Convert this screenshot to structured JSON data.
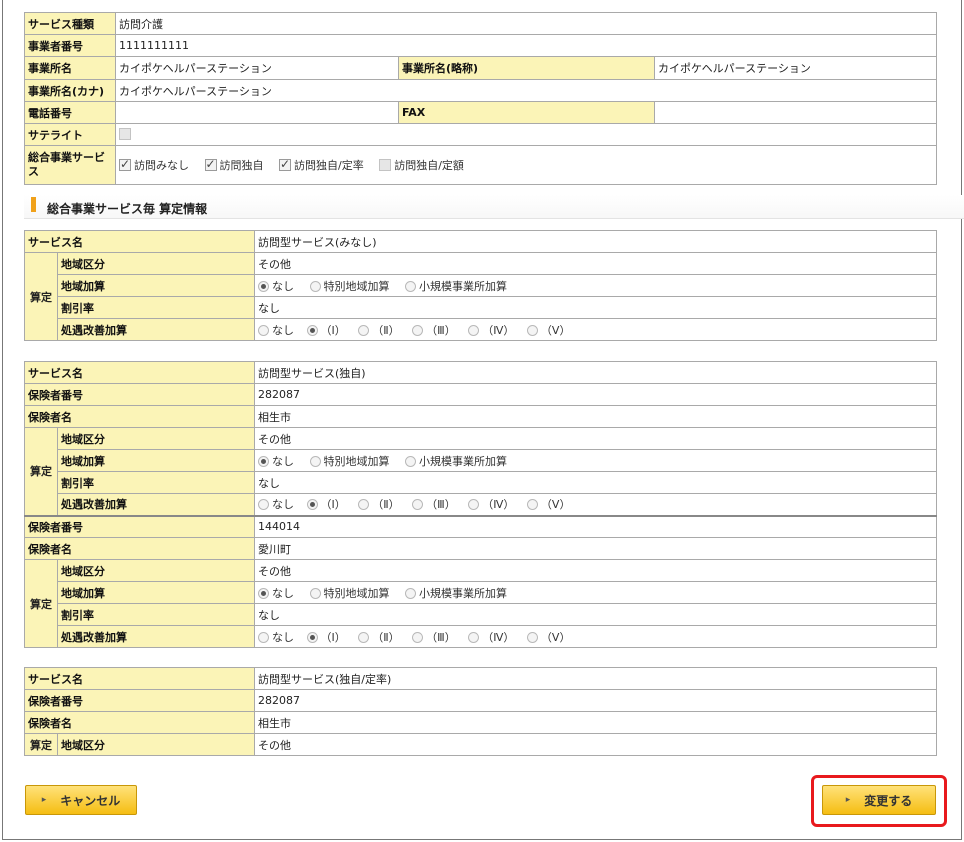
{
  "office": {
    "service_type_label": "サービス種類",
    "service_type": "訪問介護",
    "business_no_label": "事業者番号",
    "business_no": "1111111111",
    "office_name_label": "事業所名",
    "office_name": "カイポケヘルパーステーション",
    "office_short_label": "事業所名(略称)",
    "office_short": "カイポケヘルパーステーション",
    "office_kana_label": "事業所名(カナ)",
    "office_kana": "カイポケヘルパーステーション",
    "phone_label": "電話番号",
    "phone": "",
    "fax_label": "FAX",
    "fax": "",
    "satellite_label": "サテライト",
    "general_label": "総合事業サービス",
    "general_options": [
      {
        "label": "訪問みなし",
        "checked": true
      },
      {
        "label": "訪問独自",
        "checked": true
      },
      {
        "label": "訪問独自/定率",
        "checked": true
      },
      {
        "label": "訪問独自/定額",
        "checked": false
      }
    ]
  },
  "section": {
    "title": "総合事業サービス毎 算定情報"
  },
  "labels": {
    "service_name": "サービス名",
    "insurer_no": "保険者番号",
    "insurer_name": "保険者名",
    "santei": "算定",
    "region": "地域区分",
    "region_add": "地域加算",
    "discount": "割引率",
    "improvement": "処遇改善加算"
  },
  "options": {
    "region_add": [
      "なし",
      "特別地域加算",
      "小規模事業所加算"
    ],
    "improvement": [
      "なし",
      "（Ⅰ）",
      "（Ⅱ）",
      "（Ⅲ）",
      "（Ⅳ）",
      "（Ⅴ）"
    ]
  },
  "t1": {
    "service_name": "訪問型サービス(みなし)",
    "region": "その他",
    "discount": "なし"
  },
  "t2": {
    "service_name": "訪問型サービス(独自)",
    "insurer1_no": "282087",
    "insurer1_name": "相生市",
    "region1": "その他",
    "discount1": "なし",
    "insurer2_no": "144014",
    "insurer2_name": "愛川町",
    "region2": "その他",
    "discount2": "なし"
  },
  "t3": {
    "service_name": "訪問型サービス(独自/定率)",
    "insurer_no": "282087",
    "insurer_name": "相生市",
    "region": "その他"
  },
  "buttons": {
    "cancel": "キャンセル",
    "change": "変更する"
  }
}
